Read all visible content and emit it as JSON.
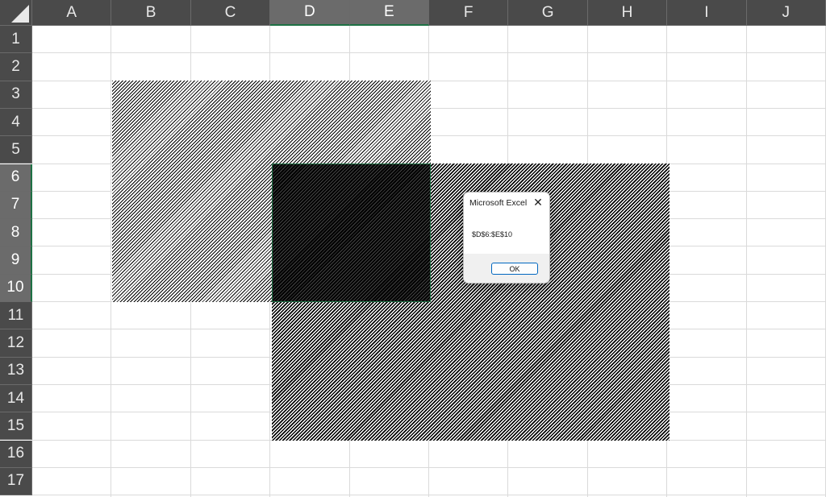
{
  "columns": [
    "A",
    "B",
    "C",
    "D",
    "E",
    "F",
    "G",
    "H",
    "I",
    "J"
  ],
  "rows": [
    "1",
    "2",
    "3",
    "4",
    "5",
    "6",
    "7",
    "8",
    "9",
    "10",
    "11",
    "12",
    "13",
    "14",
    "15",
    "16",
    "17"
  ],
  "selection": {
    "columns": [
      "D",
      "E"
    ],
    "rows": [
      "6",
      "7",
      "8",
      "9",
      "10"
    ]
  },
  "dialog": {
    "title": "Microsoft Excel",
    "close_icon": "close-icon",
    "message": "$D$6:$E$10",
    "ok_label": "OK"
  },
  "colors": {
    "header_bg": "#4a4a4a",
    "selection_accent": "#1e7145",
    "ok_border": "#0067c0"
  }
}
